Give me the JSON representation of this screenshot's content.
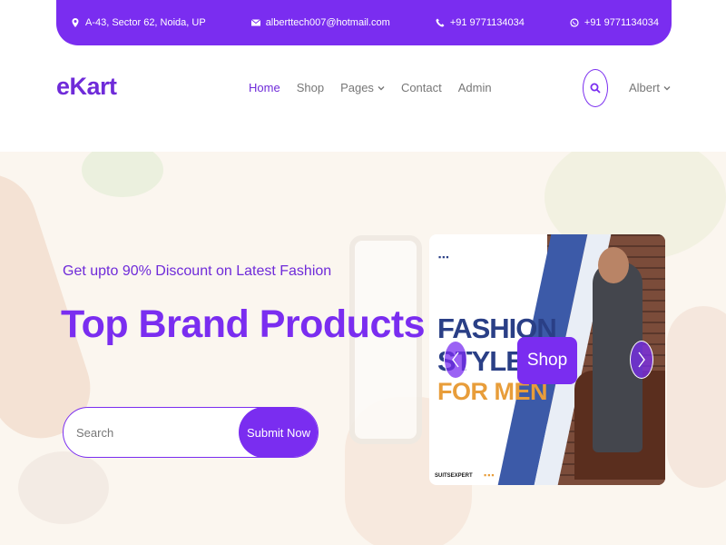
{
  "topbar": {
    "address": "A-43, Sector 62, Noida, UP",
    "address_icon": "location-pin-icon",
    "email": "alberttech007@hotmail.com",
    "email_icon": "envelope-icon",
    "phone": "+91 9771134034",
    "phone_icon": "phone-icon",
    "whatsapp": "+91 9771134034",
    "whatsapp_icon": "whatsapp-icon"
  },
  "header": {
    "logo": "eKart",
    "nav": [
      {
        "label": "Home"
      },
      {
        "label": "Shop"
      },
      {
        "label": "Pages"
      },
      {
        "label": "Contact"
      },
      {
        "label": "Admin"
      }
    ],
    "active_nav": "Home",
    "search_icon": "search-icon",
    "user": "Albert"
  },
  "hero": {
    "subtitle": "Get upto 90% Discount on Latest Fashion",
    "headline": "Top Brand Products",
    "search_placeholder": "Search",
    "submit_label": "Submit Now"
  },
  "carousel": {
    "dots_top": "▪▪▪",
    "banner_line1": "FASHION",
    "banner_line2": "STYLES",
    "banner_line3": "FOR MEN",
    "brandmark": "SUITSEXPERT",
    "dots_bottom": "▪▪▪",
    "shop_label": "Shop",
    "prev_icon": "chevron-left-icon",
    "next_icon": "chevron-right-icon"
  },
  "colors": {
    "accent": "#7a2df0",
    "navy": "#2a3f86",
    "orange": "#e89d3a"
  }
}
